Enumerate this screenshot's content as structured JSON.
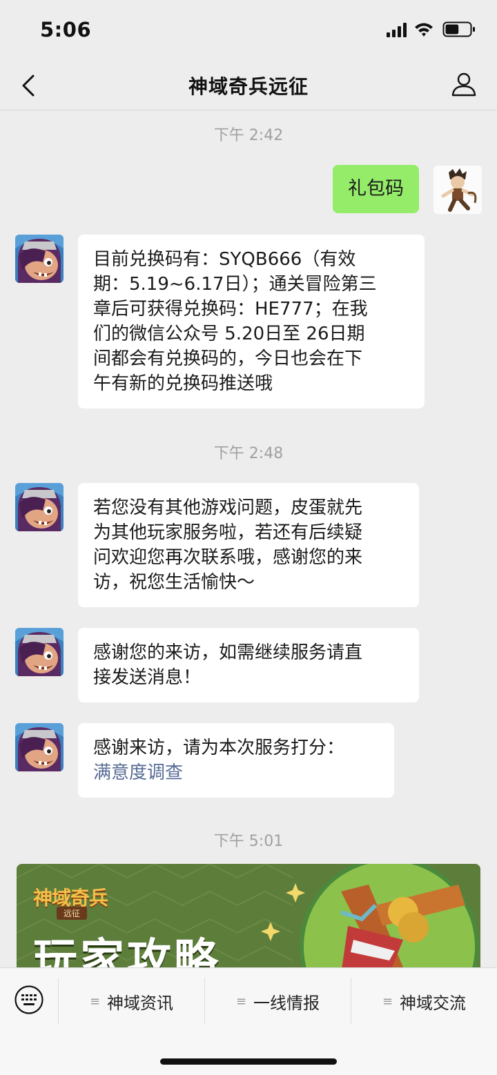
{
  "status_bar": {
    "time": "5:06",
    "battery_level": 0.55
  },
  "header": {
    "title": "神域奇兵远征",
    "back_icon": "chevron-left-icon",
    "profile_icon": "person-icon"
  },
  "messages": [
    {
      "type": "timestamp",
      "text": "下午 2:42"
    },
    {
      "type": "outgoing",
      "text": "礼包码"
    },
    {
      "type": "incoming",
      "lines": [
        "目前兑换码有：SYQB666（有效",
        "期：5.19~6.17日）；通关冒险第三",
        "章后可获得兑换码：HE777；在我",
        "们的微信公众号 5.20日至 26日期",
        "间都会有兑换码的，今日也会在下",
        "午有新的兑换码推送哦"
      ]
    },
    {
      "type": "timestamp",
      "text": "下午 2:48"
    },
    {
      "type": "incoming",
      "lines": [
        "若您没有其他游戏问题，皮蛋就先",
        "为其他玩家服务啦，若还有后续疑",
        "问欢迎您再次联系哦，感谢您的来",
        "访，祝您生活愉快～"
      ]
    },
    {
      "type": "incoming",
      "lines": [
        "感谢您的来访，如需继续服务请直",
        "接发送消息！"
      ]
    },
    {
      "type": "incoming",
      "lines": [
        "感谢来访，请为本次服务打分："
      ],
      "link": "满意度调查"
    },
    {
      "type": "timestamp",
      "text": "下午 5:01"
    }
  ],
  "banner": {
    "logo": "神域奇兵",
    "sublogo": "远征",
    "heading": "玩家攻略"
  },
  "menu": {
    "keyboard_icon": "keyboard-icon",
    "items": [
      {
        "label": "神域资讯"
      },
      {
        "label": "一线情报"
      },
      {
        "label": "神域交流"
      }
    ]
  },
  "colors": {
    "background": "#ededed",
    "outgoing_bubble": "#95ec69",
    "link": "#576b95"
  }
}
